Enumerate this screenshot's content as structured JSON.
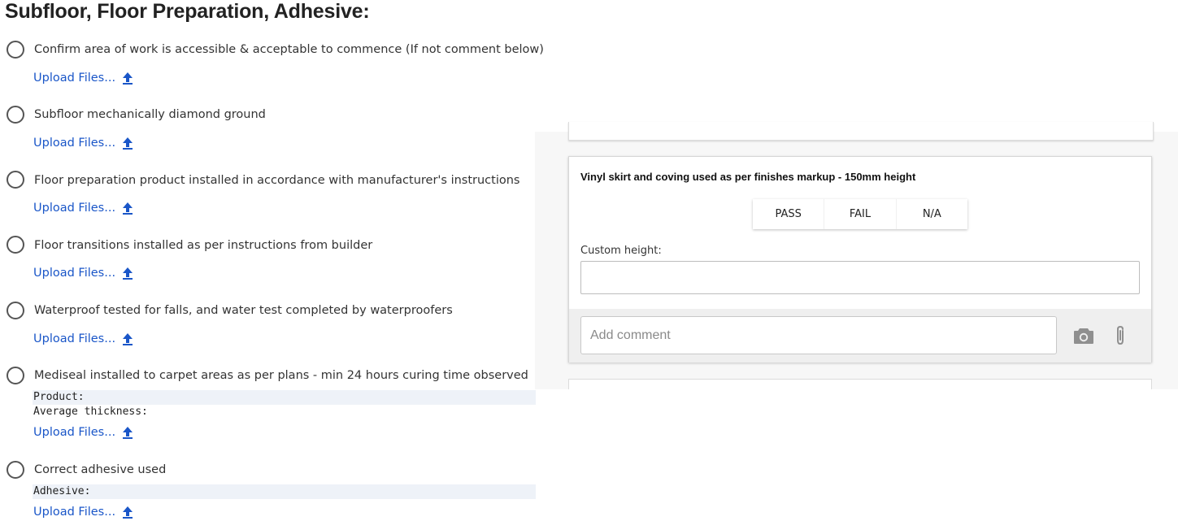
{
  "section_title": "Subfloor, Floor Preparation, Adhesive:",
  "upload_label": "Upload Files...",
  "items": [
    {
      "label": "Confirm area of work is accessible & acceptable to commence (If not comment below)"
    },
    {
      "label": "Subfloor mechanically diamond ground"
    },
    {
      "label": "Floor preparation product installed in accordance with manufacturer's instructions"
    },
    {
      "label": "Floor transitions installed as per instructions from builder"
    },
    {
      "label": "Waterproof tested for falls, and water test completed by waterproofers"
    },
    {
      "label": "Mediseal installed to carpet areas as per plans - min 24 hours curing time observed",
      "fields": [
        "Product:",
        "Average thickness:"
      ]
    },
    {
      "label": "Correct adhesive used",
      "fields": [
        "Adhesive:"
      ]
    }
  ],
  "card": {
    "title": "Vinyl skirt and coving used as per finishes markup - 150mm height",
    "options": [
      "PASS",
      "FAIL",
      "N/A"
    ],
    "custom_label": "Custom height:",
    "custom_value": "",
    "comment_placeholder": "Add comment"
  },
  "icons": {
    "upload": "upload-arrow-icon",
    "radio": "radio-unchecked-icon",
    "camera": "camera-icon",
    "attach": "paperclip-icon"
  },
  "colors": {
    "link": "#1a56c8",
    "comment_bar": "#efefef",
    "field_bg": "#eef2f8"
  }
}
